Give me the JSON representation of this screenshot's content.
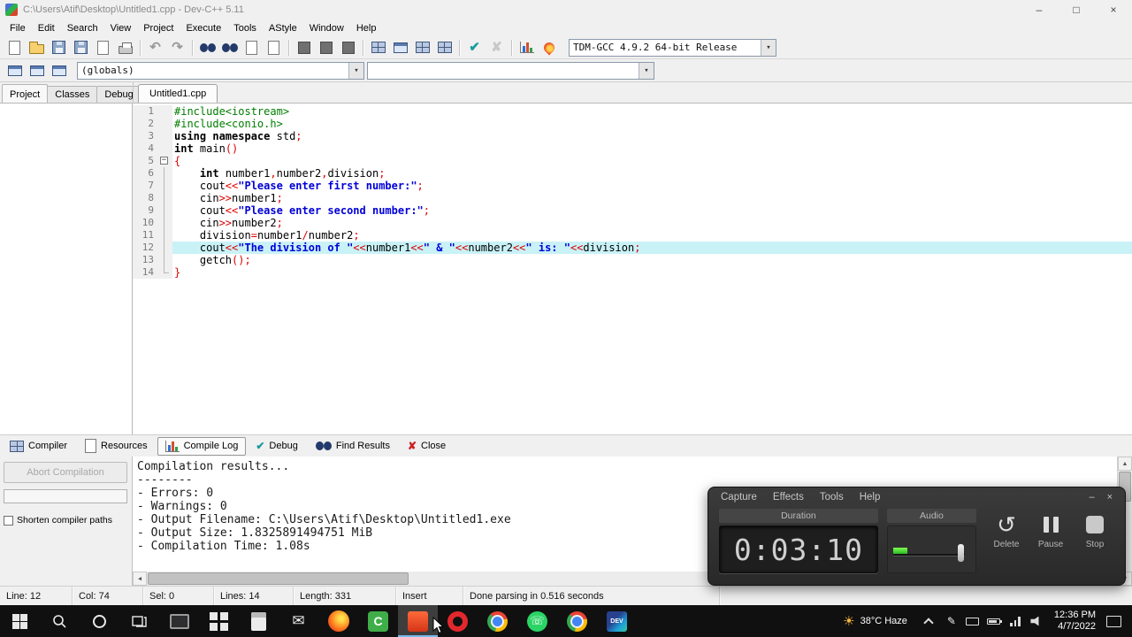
{
  "titlebar": {
    "title": "C:\\Users\\Atif\\Desktop\\Untitled1.cpp - Dev-C++ 5.11"
  },
  "icons": {
    "minimize": "–",
    "maximize": "□",
    "close": "×",
    "undo": "↶",
    "redo": "↷",
    "check": "✔",
    "cross": "✘",
    "delete": "↺",
    "combo": "▾",
    "fold_minus": "−",
    "scroll_left": "◀",
    "scroll_right": "▶",
    "scroll_up": "▲",
    "scroll_down": "▼",
    "sun": "☀",
    "mail": "✉",
    "phone": "☏",
    "pen": "✎"
  },
  "menubar": {
    "items": [
      "File",
      "Edit",
      "Search",
      "View",
      "Project",
      "Execute",
      "Tools",
      "AStyle",
      "Window",
      "Help"
    ]
  },
  "toolbar": {
    "compiler": "TDM-GCC 4.9.2 64-bit Release",
    "globals": "(globals)",
    "members": "",
    "row1": [
      {
        "name": "new-source-icon",
        "kind": "page"
      },
      {
        "name": "open-icon",
        "kind": "folder"
      },
      {
        "name": "save-icon",
        "kind": "floppy"
      },
      {
        "name": "save-all-icon",
        "kind": "floppy"
      },
      {
        "name": "close-file-icon",
        "kind": "page"
      },
      {
        "name": "print-icon",
        "kind": "printer"
      },
      {
        "sep": true
      },
      {
        "name": "undo-icon",
        "glyph": "undo",
        "disabled": true
      },
      {
        "name": "redo-icon",
        "glyph": "redo",
        "disabled": true
      },
      {
        "sep": true
      },
      {
        "name": "find-icon",
        "kind": "bino"
      },
      {
        "name": "replace-icon",
        "kind": "bino"
      },
      {
        "name": "find-next-icon",
        "kind": "page"
      },
      {
        "name": "goto-line-icon",
        "kind": "page"
      },
      {
        "sep": true
      },
      {
        "name": "compile-icon",
        "kind": "darkbox"
      },
      {
        "name": "run-icon",
        "kind": "darkbox"
      },
      {
        "name": "compile-run-icon",
        "kind": "darkbox"
      },
      {
        "sep": true
      },
      {
        "name": "rebuild-icon",
        "kind": "grid"
      },
      {
        "name": "syntax-check-icon",
        "kind": "win"
      },
      {
        "name": "project-options-icon",
        "kind": "grid"
      },
      {
        "name": "package-manager-icon",
        "kind": "grid"
      },
      {
        "sep": true
      },
      {
        "name": "format-code-icon",
        "glyph": "check",
        "color": "#1a9c9c"
      },
      {
        "name": "remove-format-icon",
        "glyph": "cross",
        "color": "#c8c8c8"
      },
      {
        "sep": true
      },
      {
        "name": "profile-icon",
        "kind": "chart"
      },
      {
        "name": "profiling-analysis-icon",
        "kind": "flame"
      }
    ],
    "row2": [
      {
        "name": "add-to-project-icon",
        "kind": "win"
      },
      {
        "name": "remove-from-project-icon",
        "kind": "win"
      },
      {
        "name": "project-properties-icon",
        "kind": "win"
      }
    ]
  },
  "nav_tabs": [
    "Project",
    "Classes",
    "Debug"
  ],
  "editor_tab": "Untitled1.cpp",
  "code": {
    "highlight_line": 12,
    "fold_line": 5,
    "last_line": 14,
    "lines": [
      {
        "n": 1,
        "seg": [
          [
            "g",
            "#include<iostream>"
          ]
        ]
      },
      {
        "n": 2,
        "seg": [
          [
            "g",
            "#include<conio.h>"
          ]
        ]
      },
      {
        "n": 3,
        "seg": [
          [
            "k",
            "using"
          ],
          [
            "p",
            " "
          ],
          [
            "k",
            "namespace"
          ],
          [
            "p",
            " std"
          ],
          [
            "y",
            ";"
          ]
        ]
      },
      {
        "n": 4,
        "seg": [
          [
            "k",
            "int"
          ],
          [
            "p",
            " main"
          ],
          [
            "y",
            "()"
          ]
        ]
      },
      {
        "n": 5,
        "seg": [
          [
            "y",
            "{"
          ]
        ]
      },
      {
        "n": 6,
        "seg": [
          [
            "p",
            "    "
          ],
          [
            "k",
            "int"
          ],
          [
            "p",
            " number1"
          ],
          [
            "y",
            ","
          ],
          [
            "p",
            "number2"
          ],
          [
            "y",
            ","
          ],
          [
            "p",
            "division"
          ],
          [
            "y",
            ";"
          ]
        ]
      },
      {
        "n": 7,
        "seg": [
          [
            "p",
            "    cout"
          ],
          [
            "y",
            "<<"
          ],
          [
            "s",
            "\"Please enter first number:\""
          ],
          [
            "y",
            ";"
          ]
        ]
      },
      {
        "n": 8,
        "seg": [
          [
            "p",
            "    cin"
          ],
          [
            "y",
            ">>"
          ],
          [
            "p",
            "number1"
          ],
          [
            "y",
            ";"
          ]
        ]
      },
      {
        "n": 9,
        "seg": [
          [
            "p",
            "    cout"
          ],
          [
            "y",
            "<<"
          ],
          [
            "s",
            "\"Please enter second number:\""
          ],
          [
            "y",
            ";"
          ]
        ]
      },
      {
        "n": 10,
        "seg": [
          [
            "p",
            "    cin"
          ],
          [
            "y",
            ">>"
          ],
          [
            "p",
            "number2"
          ],
          [
            "y",
            ";"
          ]
        ]
      },
      {
        "n": 11,
        "seg": [
          [
            "p",
            "    division"
          ],
          [
            "y",
            "="
          ],
          [
            "p",
            "number1"
          ],
          [
            "y",
            "/"
          ],
          [
            "p",
            "number2"
          ],
          [
            "y",
            ";"
          ]
        ]
      },
      {
        "n": 12,
        "seg": [
          [
            "p",
            "    cout"
          ],
          [
            "y",
            "<<"
          ],
          [
            "s",
            "\"The division of \""
          ],
          [
            "y",
            "<<"
          ],
          [
            "p",
            "number1"
          ],
          [
            "y",
            "<<"
          ],
          [
            "s",
            "\" & \""
          ],
          [
            "y",
            "<<"
          ],
          [
            "p",
            "number2"
          ],
          [
            "y",
            "<<"
          ],
          [
            "s",
            "\" is: \""
          ],
          [
            "y",
            "<<"
          ],
          [
            "p",
            "division"
          ],
          [
            "y",
            ";"
          ]
        ]
      },
      {
        "n": 13,
        "seg": [
          [
            "p",
            "    getch"
          ],
          [
            "y",
            "();"
          ]
        ]
      },
      {
        "n": 14,
        "seg": [
          [
            "y",
            "}"
          ]
        ]
      }
    ]
  },
  "bottom_tabs": [
    {
      "label": "Compiler",
      "icon": "grid"
    },
    {
      "label": "Resources",
      "icon": "page"
    },
    {
      "label": "Compile Log",
      "icon": "chart",
      "active": true
    },
    {
      "label": "Debug",
      "icon": "check"
    },
    {
      "label": "Find Results",
      "icon": "bino"
    },
    {
      "label": "Close",
      "icon": "cross"
    }
  ],
  "compile_panel": {
    "abort": "Abort Compilation",
    "shorten": "Shorten compiler paths",
    "log": [
      "Compilation results...",
      "--------",
      "- Errors: 0",
      "- Warnings: 0",
      "- Output Filename: C:\\Users\\Atif\\Desktop\\Untitled1.exe",
      "- Output Size: 1.8325891494751 MiB",
      "- Compilation Time: 1.08s"
    ]
  },
  "statusbar": {
    "items": [
      "Line: 12",
      "Col: 74",
      "Sel: 0",
      "Lines: 14",
      "Length: 331",
      "Insert",
      "Done parsing in 0.516 seconds"
    ],
    "widths": [
      82,
      80,
      80,
      90,
      116,
      76,
      290
    ]
  },
  "recorder": {
    "menu": [
      "Capture",
      "Effects",
      "Tools",
      "Help"
    ],
    "duration_label": "Duration",
    "duration": "0:03:10",
    "audio_label": "Audio",
    "delete_label": "Delete",
    "pause_label": "Pause",
    "stop_label": "Stop"
  },
  "taskbar": {
    "apps": [
      {
        "name": "pc"
      },
      {
        "name": "store"
      },
      {
        "name": "calculator"
      },
      {
        "name": "mail",
        "glyph": "mail"
      },
      {
        "name": "firefox"
      },
      {
        "name": "devc-green",
        "letter": "C"
      },
      {
        "name": "recorder",
        "active": true
      },
      {
        "name": "opera"
      },
      {
        "name": "chrome"
      },
      {
        "name": "whatsapp",
        "glyph": "phone"
      },
      {
        "name": "chrome2"
      },
      {
        "name": "devcpp",
        "letter": "DEV"
      }
    ],
    "weather": "38°C Haze",
    "time": "12:36 PM",
    "date": "4/7/2022"
  }
}
